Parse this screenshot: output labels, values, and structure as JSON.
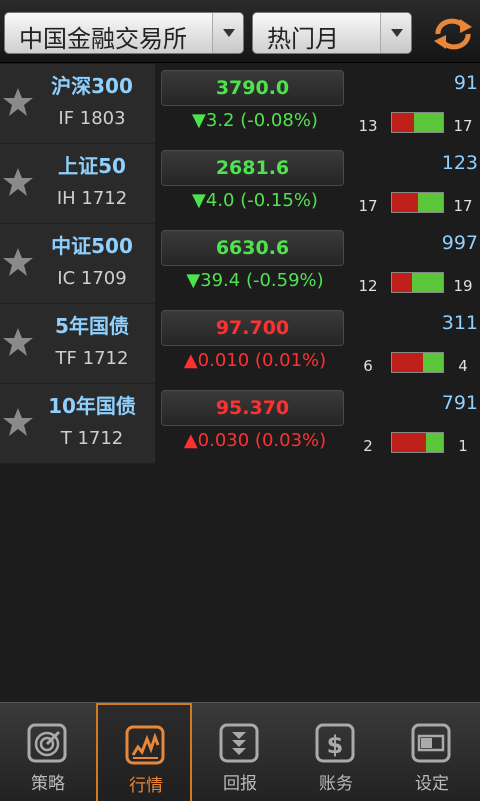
{
  "header": {
    "exchange_select": "中国金融交易所",
    "period_select": "热门月"
  },
  "rows": [
    {
      "name": "沪深300",
      "code": "IF 1803",
      "price": "3790.0",
      "change": "▼3.2 (-0.08%)",
      "direction": "down",
      "volume": "91",
      "buy": "13",
      "sell": "17",
      "buy_ratio": 0.43
    },
    {
      "name": "上证50",
      "code": "IH 1712",
      "price": "2681.6",
      "change": "▼4.0 (-0.15%)",
      "direction": "down",
      "volume": "123",
      "buy": "17",
      "sell": "17",
      "buy_ratio": 0.5
    },
    {
      "name": "中证500",
      "code": "IC 1709",
      "price": "6630.6",
      "change": "▼39.4 (-0.59%)",
      "direction": "down",
      "volume": "997",
      "buy": "12",
      "sell": "19",
      "buy_ratio": 0.39
    },
    {
      "name": "5年国债",
      "code": "TF 1712",
      "price": "97.700",
      "change": "▲0.010 (0.01%)",
      "direction": "up",
      "volume": "311",
      "buy": "6",
      "sell": "4",
      "buy_ratio": 0.6
    },
    {
      "name": "10年国债",
      "code": "T 1712",
      "price": "95.370",
      "change": "▲0.030 (0.03%)",
      "direction": "up",
      "volume": "791",
      "buy": "2",
      "sell": "1",
      "buy_ratio": 0.67
    }
  ],
  "tabs": [
    {
      "label": "策略",
      "icon": "target-icon",
      "active": false
    },
    {
      "label": "行情",
      "icon": "chart-icon",
      "active": true
    },
    {
      "label": "回报",
      "icon": "download-arrows-icon",
      "active": false
    },
    {
      "label": "账务",
      "icon": "dollar-icon",
      "active": false
    },
    {
      "label": "设定",
      "icon": "toggle-icon",
      "active": false
    }
  ],
  "colors": {
    "up": "#ff3030",
    "down": "#4fe24f",
    "accent": "#e8873a",
    "name": "#8fd0ff"
  }
}
